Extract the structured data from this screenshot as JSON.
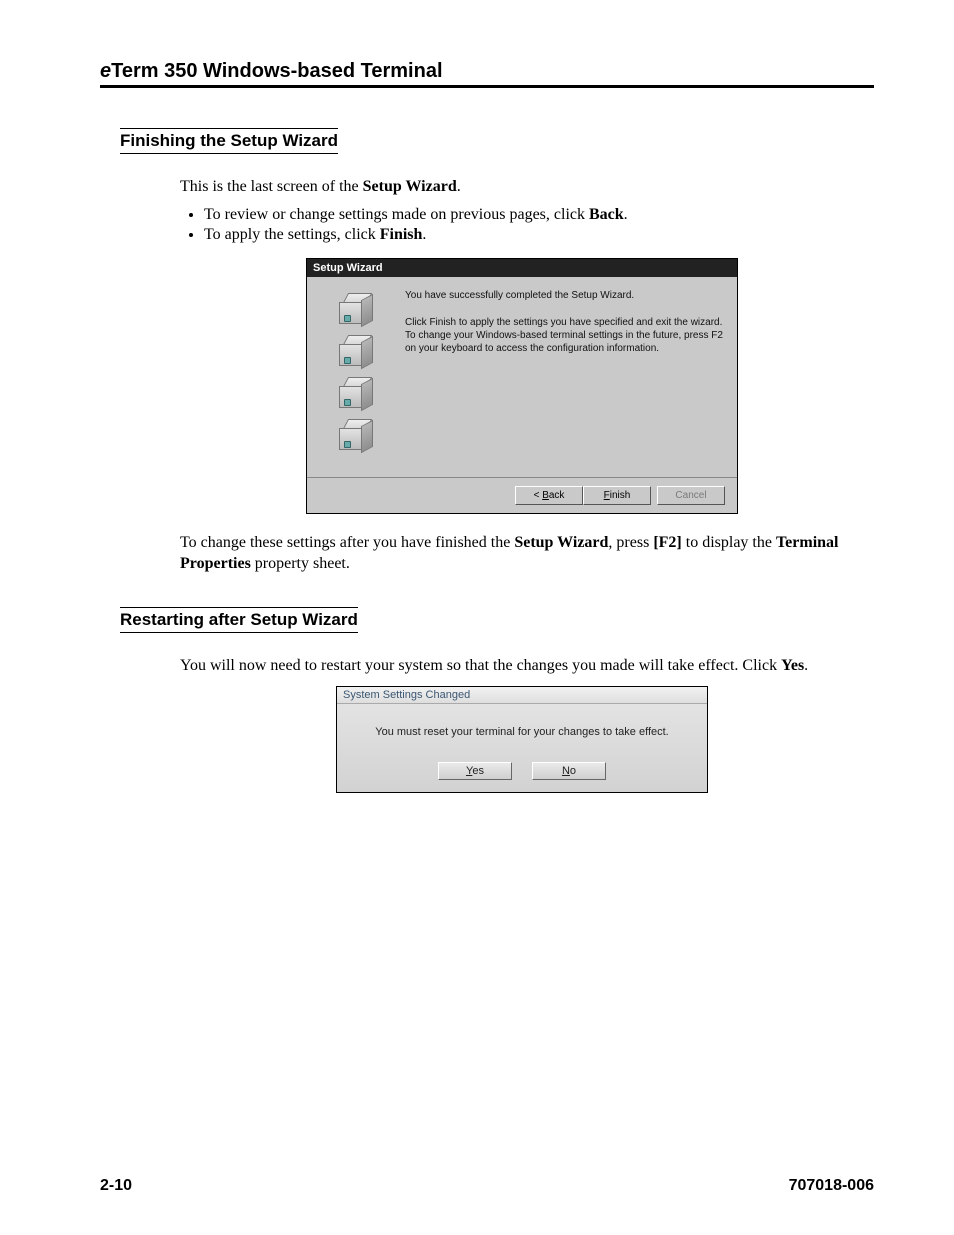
{
  "header": {
    "prefix": "e",
    "title": "Term 350 Windows-based Terminal"
  },
  "section1": {
    "heading": "Finishing the Setup Wizard",
    "intro_a": "This is the last screen of the ",
    "intro_b": "Setup Wizard",
    "intro_c": ".",
    "bullet1_a": "To review or change settings made on previous pages, click ",
    "bullet1_b": "Back",
    "bullet1_c": ".",
    "bullet2_a": "To apply the settings, click ",
    "bullet2_b": "Finish",
    "bullet2_c": ".",
    "post_a": "To change these settings after you have finished the ",
    "post_b": "Setup Wizard",
    "post_c": ", press ",
    "post_d": "[F2]",
    "post_e": " to display the ",
    "post_f": "Terminal Properties",
    "post_g": " property sheet."
  },
  "wizard": {
    "title": "Setup Wizard",
    "msg1": "You have successfully completed the Setup Wizard.",
    "msg2": "Click Finish to apply the settings you have specified and exit the wizard.",
    "msg3": "To change your Windows-based terminal settings in the future, press F2 on your keyboard to access the configuration information.",
    "back_pre": "< ",
    "back_u": "B",
    "back_post": "ack",
    "finish_u": "F",
    "finish_post": "inish",
    "cancel": "Cancel"
  },
  "section2": {
    "heading": "Restarting after Setup Wizard",
    "p_a": "You will now need to restart your system so that the changes you made will take effect. Click ",
    "p_b": "Yes",
    "p_c": "."
  },
  "dialog": {
    "title": "System Settings Changed",
    "msg": "You must reset your terminal for your changes to take effect.",
    "yes_u": "Y",
    "yes_post": "es",
    "no_u": "N",
    "no_post": "o"
  },
  "footer": {
    "page": "2-10",
    "doc": "707018-006"
  }
}
